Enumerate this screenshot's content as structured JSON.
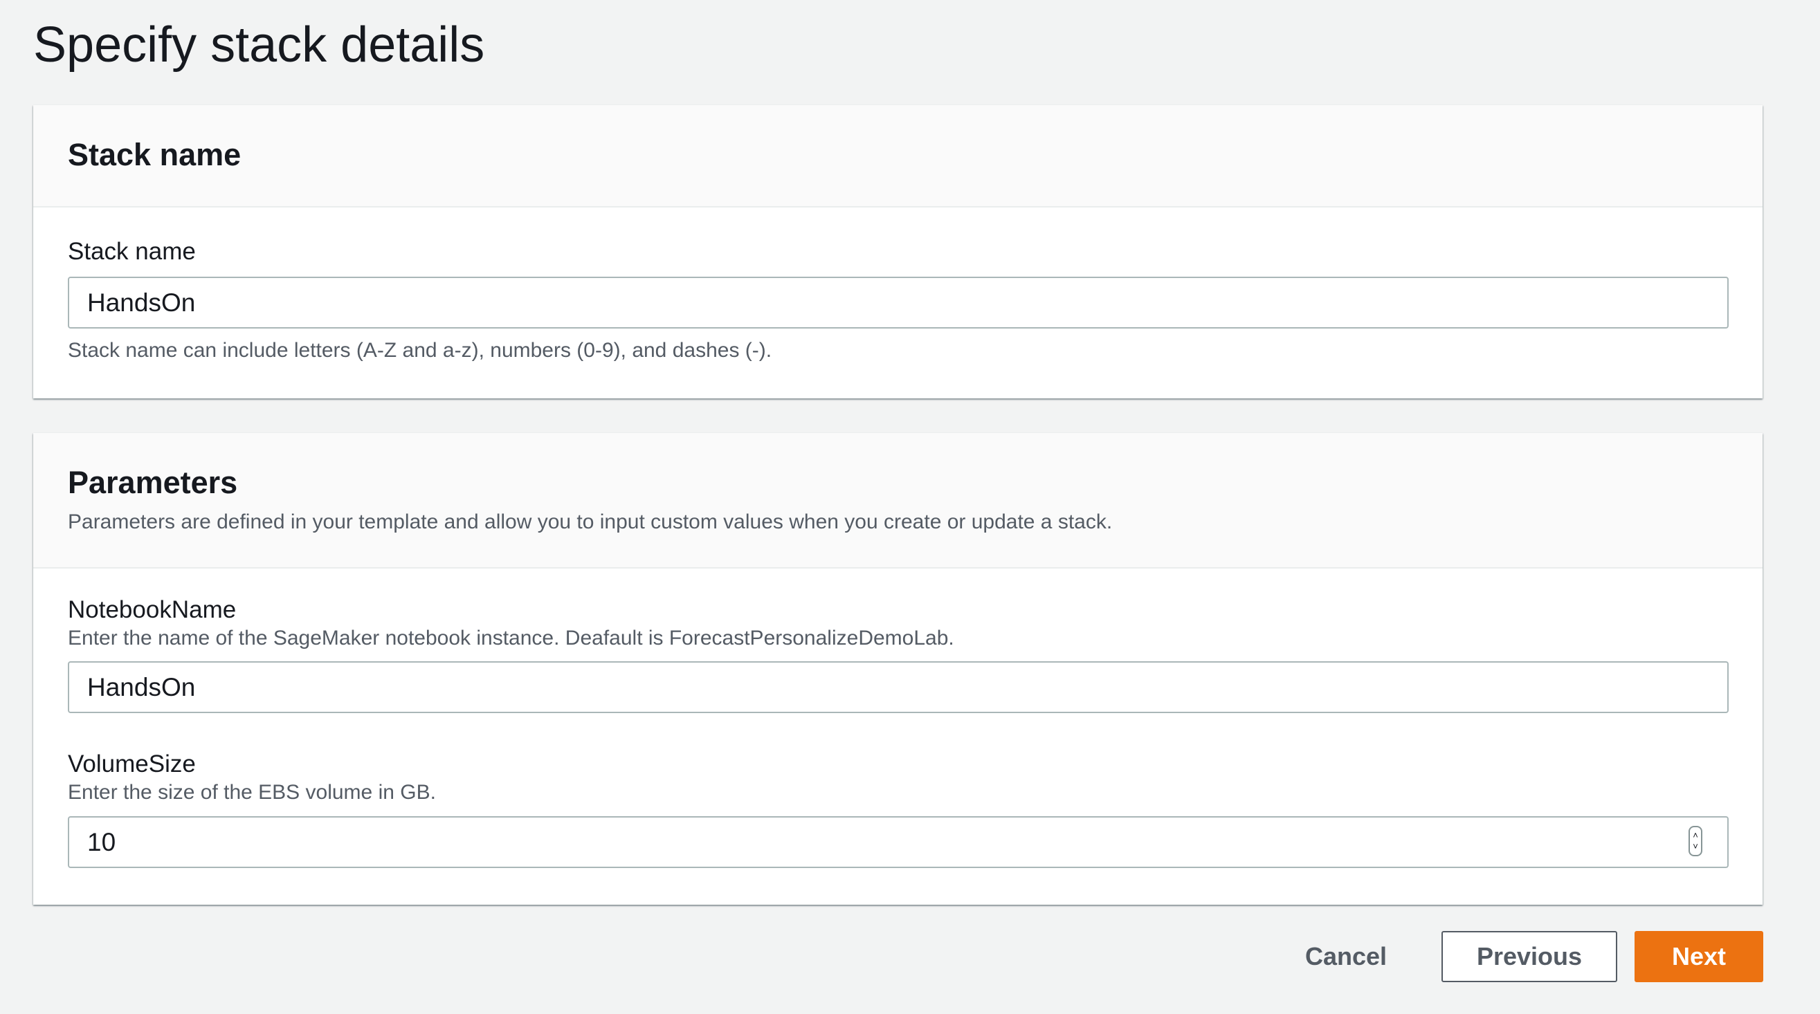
{
  "page": {
    "title": "Specify stack details"
  },
  "stack_name_panel": {
    "title": "Stack name",
    "field": {
      "label": "Stack name",
      "value": "HandsOn",
      "hint": "Stack name can include letters (A-Z and a-z), numbers (0-9), and dashes (-)."
    }
  },
  "parameters_panel": {
    "title": "Parameters",
    "description": "Parameters are defined in your template and allow you to input custom values when you create or update a stack.",
    "notebook_name": {
      "label": "NotebookName",
      "description": "Enter the name of the SageMaker notebook instance. Deafault is ForecastPersonalizeDemoLab.",
      "value": "HandsOn"
    },
    "volume_size": {
      "label": "VolumeSize",
      "description": "Enter the size of the EBS volume in GB.",
      "value": "10",
      "spinner_icon": "up-down-spinner-icon"
    }
  },
  "footer": {
    "cancel_label": "Cancel",
    "previous_label": "Previous",
    "next_label": "Next",
    "next_color": "#ec7211"
  }
}
